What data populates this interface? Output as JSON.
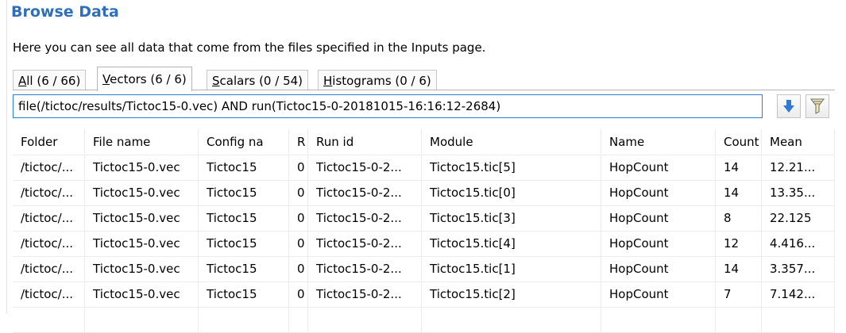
{
  "title": "Browse Data",
  "description": "Here you can see all data that come from the files specified in the Inputs page.",
  "tabs": [
    {
      "label": "All (6 / 66)",
      "mnemonic": "A",
      "rest": "ll (6 / 66)",
      "active": false
    },
    {
      "label": "Vectors (6 / 6)",
      "mnemonic": "V",
      "rest": "ectors (6 / 6)",
      "active": true
    },
    {
      "label": "Scalars (0 / 54)",
      "mnemonic": "S",
      "rest": "calars (0 / 54)",
      "active": false
    },
    {
      "label": "Histograms (0 / 6)",
      "mnemonic": "H",
      "rest": "istograms (0 / 6)",
      "active": false
    }
  ],
  "filter": {
    "value": "file(/tictoc/results/Tictoc15-0.vec) AND run(Tictoc15-0-20181015-16:16:12-2684)"
  },
  "toolbar": {
    "down_icon": "download-arrow-icon",
    "filter_icon": "filter-funnel-icon",
    "accent": "#2f7bd4"
  },
  "table": {
    "columns": [
      "Folder",
      "File name",
      "Config na",
      "R",
      "Run id",
      "Module",
      "Name",
      "Count",
      "Mean"
    ],
    "rows": [
      [
        "/tictoc/...",
        "Tictoc15-0.vec",
        "Tictoc15",
        "0",
        "Tictoc15-0-2...",
        "Tictoc15.tic[5]",
        "HopCount",
        "14",
        "12.21..."
      ],
      [
        "/tictoc/...",
        "Tictoc15-0.vec",
        "Tictoc15",
        "0",
        "Tictoc15-0-2...",
        "Tictoc15.tic[0]",
        "HopCount",
        "14",
        "13.35..."
      ],
      [
        "/tictoc/...",
        "Tictoc15-0.vec",
        "Tictoc15",
        "0",
        "Tictoc15-0-2...",
        "Tictoc15.tic[3]",
        "HopCount",
        "8",
        "22.125"
      ],
      [
        "/tictoc/...",
        "Tictoc15-0.vec",
        "Tictoc15",
        "0",
        "Tictoc15-0-2...",
        "Tictoc15.tic[4]",
        "HopCount",
        "12",
        "4.416..."
      ],
      [
        "/tictoc/...",
        "Tictoc15-0.vec",
        "Tictoc15",
        "0",
        "Tictoc15-0-2...",
        "Tictoc15.tic[1]",
        "HopCount",
        "14",
        "3.357..."
      ],
      [
        "/tictoc/...",
        "Tictoc15-0.vec",
        "Tictoc15",
        "0",
        "Tictoc15-0-2...",
        "Tictoc15.tic[2]",
        "HopCount",
        "7",
        "7.142..."
      ]
    ]
  },
  "colors": {
    "title": "#2f6fb9",
    "grid_line": "#ececec"
  }
}
